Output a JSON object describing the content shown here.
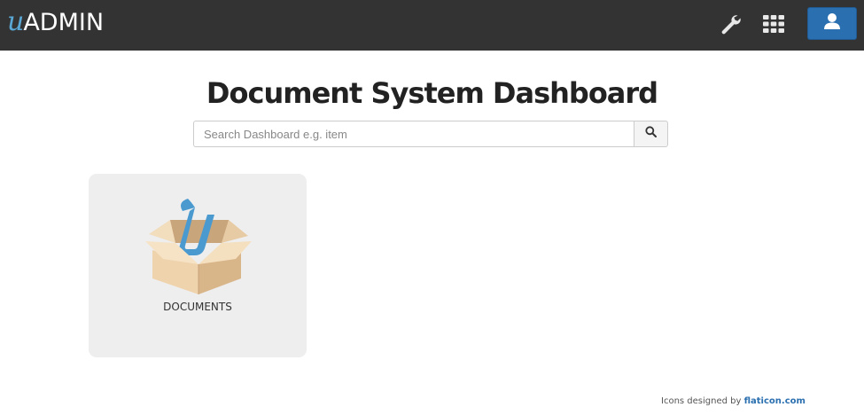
{
  "header": {
    "brand_u": "u",
    "brand_text": "ADMIN",
    "icons": [
      "wrench-icon",
      "grid-icon",
      "user-icon"
    ],
    "user_button_color": "#2a6fb0",
    "background_color": "#333333"
  },
  "main": {
    "title": "Document System Dashboard",
    "search": {
      "placeholder": "Search Dashboard e.g. item",
      "value": "",
      "button_icon": "search-icon"
    },
    "tiles": [
      {
        "label": "DOCUMENTS",
        "icon": "box-icon"
      }
    ]
  },
  "footer": {
    "credit_prefix": "Icons designed by",
    "credit_link": "flaticon.com"
  }
}
